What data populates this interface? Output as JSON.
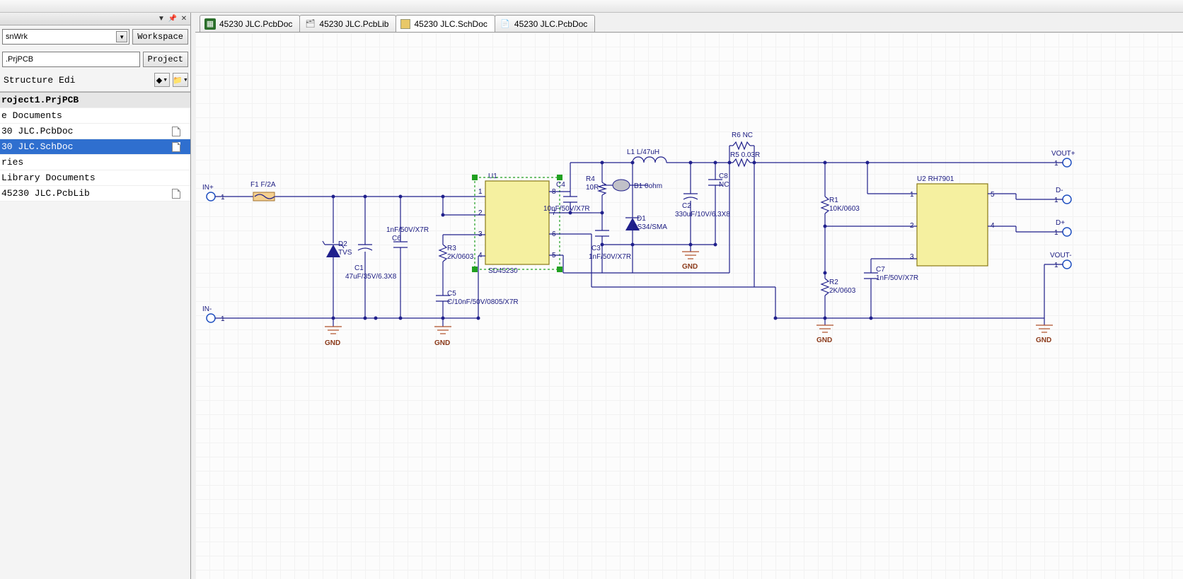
{
  "panel": {
    "pin_icon": "▼",
    "pushpin": "📌",
    "close": "✕",
    "workspace_field": "snWrk",
    "workspace_btn": "Workspace",
    "project_field": ".PrjPCB",
    "project_btn": "Project",
    "structure_label": "Structure Edi"
  },
  "tree": {
    "items": [
      {
        "label": "roject1.PrjPCB",
        "bold": true
      },
      {
        "label": "e Documents"
      },
      {
        "label": "30 JLC.PcbDoc",
        "doc": true
      },
      {
        "label": "30 JLC.SchDoc",
        "doc": true,
        "sel": true
      },
      {
        "label": "ries"
      },
      {
        "label": "  Library Documents"
      },
      {
        "label": "45230 JLC.PcbLib",
        "doc": true
      }
    ]
  },
  "tabs": [
    {
      "label": "45230 JLC.PcbDoc",
      "ico": "pcb"
    },
    {
      "label": "45230 JLC.PcbLib",
      "ico": "lib"
    },
    {
      "label": "45230 JLC.SchDoc",
      "ico": "sch",
      "active": true
    },
    {
      "label": "45230 JLC.PcbDoc",
      "ico": "doc2"
    }
  ],
  "ports": {
    "in_plus": "IN+",
    "in_minus": "IN-",
    "vout_plus": "VOUT+",
    "vout_minus": "VOUT-",
    "d_plus": "D+",
    "d_minus": "D-"
  },
  "components": {
    "F1": {
      "ref": "F1",
      "val": "F/2A"
    },
    "D2": {
      "ref": "D2",
      "val": "TVS"
    },
    "C1": {
      "ref": "C1",
      "val": "47uF/35V/6.3X8"
    },
    "C6": {
      "ref": "C6",
      "val": "1nF/50V/X7R"
    },
    "R3": {
      "ref": "R3",
      "val": "2K/0603"
    },
    "C5": {
      "ref": "C5",
      "val": "C/10nF/50V/0805/X7R"
    },
    "U1": {
      "ref": "U1",
      "val": "SD45230"
    },
    "C4": {
      "ref": "C4",
      "val": "10nF/50V/X7R"
    },
    "R4": {
      "ref": "R4",
      "val": "10R"
    },
    "C3": {
      "ref": "C3",
      "val": "1nF/50V/X7R"
    },
    "D1": {
      "ref": "D1",
      "val": "SS34/SMA"
    },
    "L1": {
      "ref": "L1",
      "val": "L/47uH"
    },
    "B1": {
      "ref": "B1",
      "val": "0ohm"
    },
    "C2": {
      "ref": "C2",
      "val": "330uF/10V/6.3X8"
    },
    "C8": {
      "ref": "C8",
      "val": "NC"
    },
    "R5": {
      "ref": "R5",
      "val": "0.03R"
    },
    "R6": {
      "ref": "R6",
      "val": "NC"
    },
    "R1": {
      "ref": "R1",
      "val": "10K/0603"
    },
    "R2": {
      "ref": "R2",
      "val": "2K/0603"
    },
    "C7": {
      "ref": "C7",
      "val": "1nF/50V/X7R"
    },
    "U2": {
      "ref": "U2",
      "val": "RH7901"
    }
  },
  "labels": {
    "gnd": "GND",
    "pins": {
      "p1": "1",
      "p2": "2",
      "p3": "3",
      "p4": "4",
      "p5": "5",
      "p6": "6",
      "p7": "7",
      "p8": "8"
    }
  }
}
